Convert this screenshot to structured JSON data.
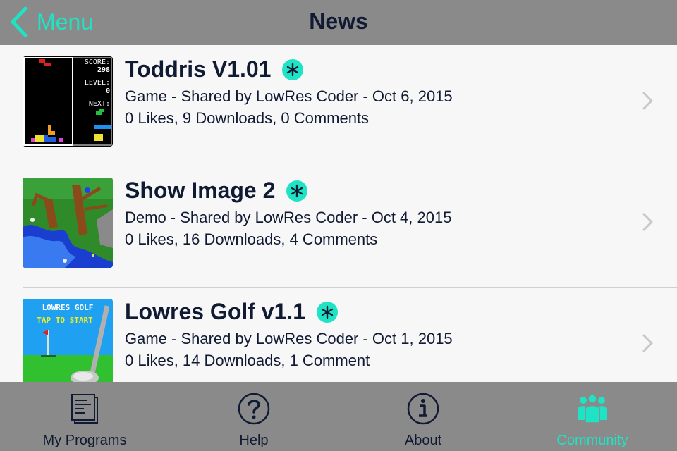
{
  "nav": {
    "back_label": "Menu",
    "title": "News"
  },
  "items": [
    {
      "title": "Toddris V1.01",
      "meta": "Game - Shared by LowRes Coder - Oct 6, 2015",
      "stats": "0 Likes, 9 Downloads, 0 Comments",
      "thumb_text": [
        "SCORE:",
        "298",
        "LEVEL:",
        "0",
        "NEXT:"
      ]
    },
    {
      "title": "Show Image 2",
      "meta": "Demo - Shared by LowRes Coder - Oct 4, 2015",
      "stats": "0 Likes, 16 Downloads, 4 Comments"
    },
    {
      "title": "Lowres Golf v1.1",
      "meta": "Game - Shared by LowRes Coder - Oct 1, 2015",
      "stats": "0 Likes, 14 Downloads, 1 Comment",
      "thumb_text": [
        "LOWRES GOLF",
        "TAP TO START"
      ]
    }
  ],
  "tabs": [
    {
      "label": "My Programs",
      "icon": "programs-icon"
    },
    {
      "label": "Help",
      "icon": "help-icon"
    },
    {
      "label": "About",
      "icon": "info-icon"
    },
    {
      "label": "Community",
      "icon": "community-icon",
      "active": true
    }
  ],
  "colors": {
    "accent": "#1fe3c4",
    "bar": "#8a8a8a",
    "text": "#111a33"
  }
}
